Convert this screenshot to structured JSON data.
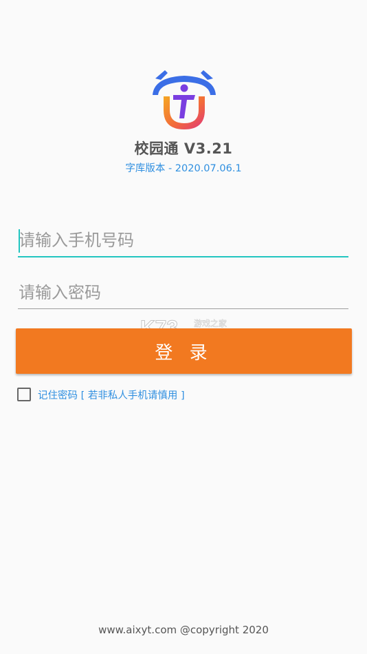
{
  "app": {
    "title": "校园通 V3.21",
    "version_info": "字库版本 - 2020.07.06.1"
  },
  "form": {
    "phone": {
      "value": "",
      "placeholder": "请输入手机号码"
    },
    "password": {
      "value": "",
      "placeholder": "请输入密码"
    },
    "login_label": "登 录",
    "remember": {
      "checked": false,
      "label": "记住密码 [ 若非私人手机请慎用 ]"
    }
  },
  "watermark": {
    "brand": "K73",
    "text": "游戏之家"
  },
  "footer": {
    "text": "www.aixyt.com @copyright 2020"
  },
  "colors": {
    "accent": "#f27920",
    "link": "#2f8fe0",
    "focus": "#21c5c0",
    "logo_blue": "#3b6ee6",
    "logo_orange": "#f27920",
    "logo_purple": "#7a3ee0"
  },
  "icons": {
    "logo": "campus-logo-icon",
    "checkbox": "checkbox-unchecked-icon"
  }
}
